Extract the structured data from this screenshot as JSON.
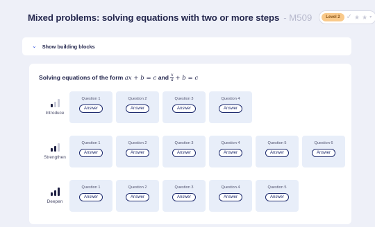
{
  "header": {
    "title": "Mixed problems: solving equations with two or more steps",
    "code": "- M509",
    "level_badge": "Level 2",
    "info_symbol": "i"
  },
  "building_blocks": {
    "label": "Show building blocks"
  },
  "card": {
    "title_prefix": "Solving equations of the form",
    "math1": "ax + b = c",
    "title_and": "and",
    "math2_num": "x",
    "math2_den": "a",
    "math2_rest": "+ b = c",
    "rows": [
      {
        "name": "Introduce",
        "level_bars_filled": 1,
        "questions": [
          "Question 1",
          "Question 2",
          "Question 3",
          "Question 4"
        ]
      },
      {
        "name": "Strengthen",
        "level_bars_filled": 2,
        "questions": [
          "Question 1",
          "Question 2",
          "Question 3",
          "Question 4",
          "Question 5",
          "Question 6"
        ]
      },
      {
        "name": "Deepen",
        "level_bars_filled": 3,
        "questions": [
          "Question 1",
          "Question 2",
          "Question 3",
          "Question 4",
          "Question 5"
        ]
      }
    ],
    "answer_label": "Answer"
  },
  "colors": {
    "accent": "#2f6ef2",
    "tile": "#e8eef9",
    "level_badge": "#f9c98a",
    "text": "#23264d"
  }
}
